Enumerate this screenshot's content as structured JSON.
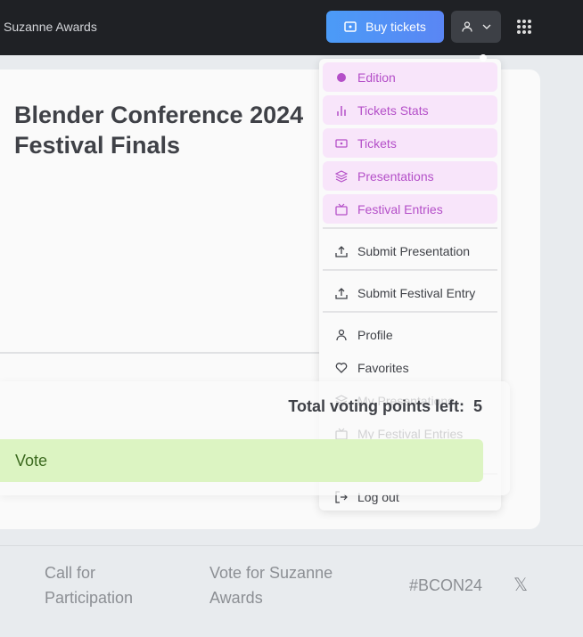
{
  "header": {
    "brand": "Suzanne Awards",
    "buy_tickets": "Buy tickets"
  },
  "main": {
    "title": "Blender Conference 2024 Festival Finals",
    "voting_points_label": "Total voting points left:",
    "voting_points": "5",
    "vote_button": "Vote"
  },
  "menu": {
    "items": [
      {
        "label": "Edition",
        "icon": "edition-icon",
        "highlighted": true
      },
      {
        "label": "Tickets Stats",
        "icon": "bar-chart-icon",
        "highlighted": true
      },
      {
        "label": "Tickets",
        "icon": "ticket-icon",
        "highlighted": true
      },
      {
        "label": "Presentations",
        "icon": "layers-icon",
        "highlighted": true
      },
      {
        "label": "Festival Entries",
        "icon": "tv-icon",
        "highlighted": true
      },
      {
        "label": "Submit Presentation",
        "icon": "upload-icon"
      },
      {
        "label": "Submit Festival Entry",
        "icon": "upload-icon"
      },
      {
        "label": "Profile",
        "icon": "user-icon"
      },
      {
        "label": "Favorites",
        "icon": "heart-icon"
      },
      {
        "label": "My Presentations",
        "icon": "layers-icon"
      },
      {
        "label": "My Festival Entries",
        "icon": "tv-icon"
      },
      {
        "label": "Log out",
        "icon": "logout-icon"
      }
    ]
  },
  "footer": {
    "call": "Call for Participation",
    "vote": "Vote for Suzanne Awards",
    "hashtag": "#BCON24"
  },
  "colors": {
    "accent": "#b44fc8",
    "buy": "#4b9bf7",
    "vote_bg": "#dcf4c2"
  }
}
